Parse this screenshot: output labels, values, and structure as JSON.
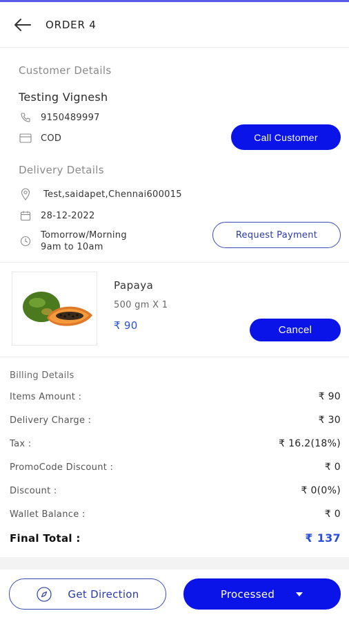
{
  "header": {
    "title": "ORDER 4",
    "back_icon": "arrow-left-icon"
  },
  "customer": {
    "section_label": "Customer Details",
    "name": "Testing Vignesh",
    "phone": "9150489997",
    "payment_method": "COD",
    "call_button": "Call Customer"
  },
  "delivery": {
    "section_label": "Delivery Details",
    "address": "Test,saidapet,Chennai600015",
    "date": "28-12-2022",
    "slot_line1": "Tomorrow/Morning",
    "slot_line2": "9am to 10am",
    "request_payment_button": "Request Payment"
  },
  "product": {
    "name": "Papaya",
    "quantity": "500 gm X 1",
    "price": "₹ 90",
    "cancel_button": "Cancel"
  },
  "billing": {
    "title": "Billing Details",
    "rows": [
      {
        "label": "Items Amount :",
        "value": "₹ 90"
      },
      {
        "label": "Delivery Charge :",
        "value": "₹ 30"
      },
      {
        "label": "Tax :",
        "value": "₹ 16.2(18%)"
      },
      {
        "label": "PromoCode Discount :",
        "value": "₹ 0"
      },
      {
        "label": "Discount :",
        "value": "₹ 0(0%)"
      },
      {
        "label": "Wallet Balance :",
        "value": "₹ 0"
      }
    ],
    "final_label": "Final Total :",
    "final_value": "₹ 137"
  },
  "actions": {
    "direction_button": "Get Direction",
    "status_button": "Processed"
  },
  "colors": {
    "primary": "#0a14e8",
    "accent_text": "#2a4fd6",
    "outline": "#3b4bb5"
  }
}
